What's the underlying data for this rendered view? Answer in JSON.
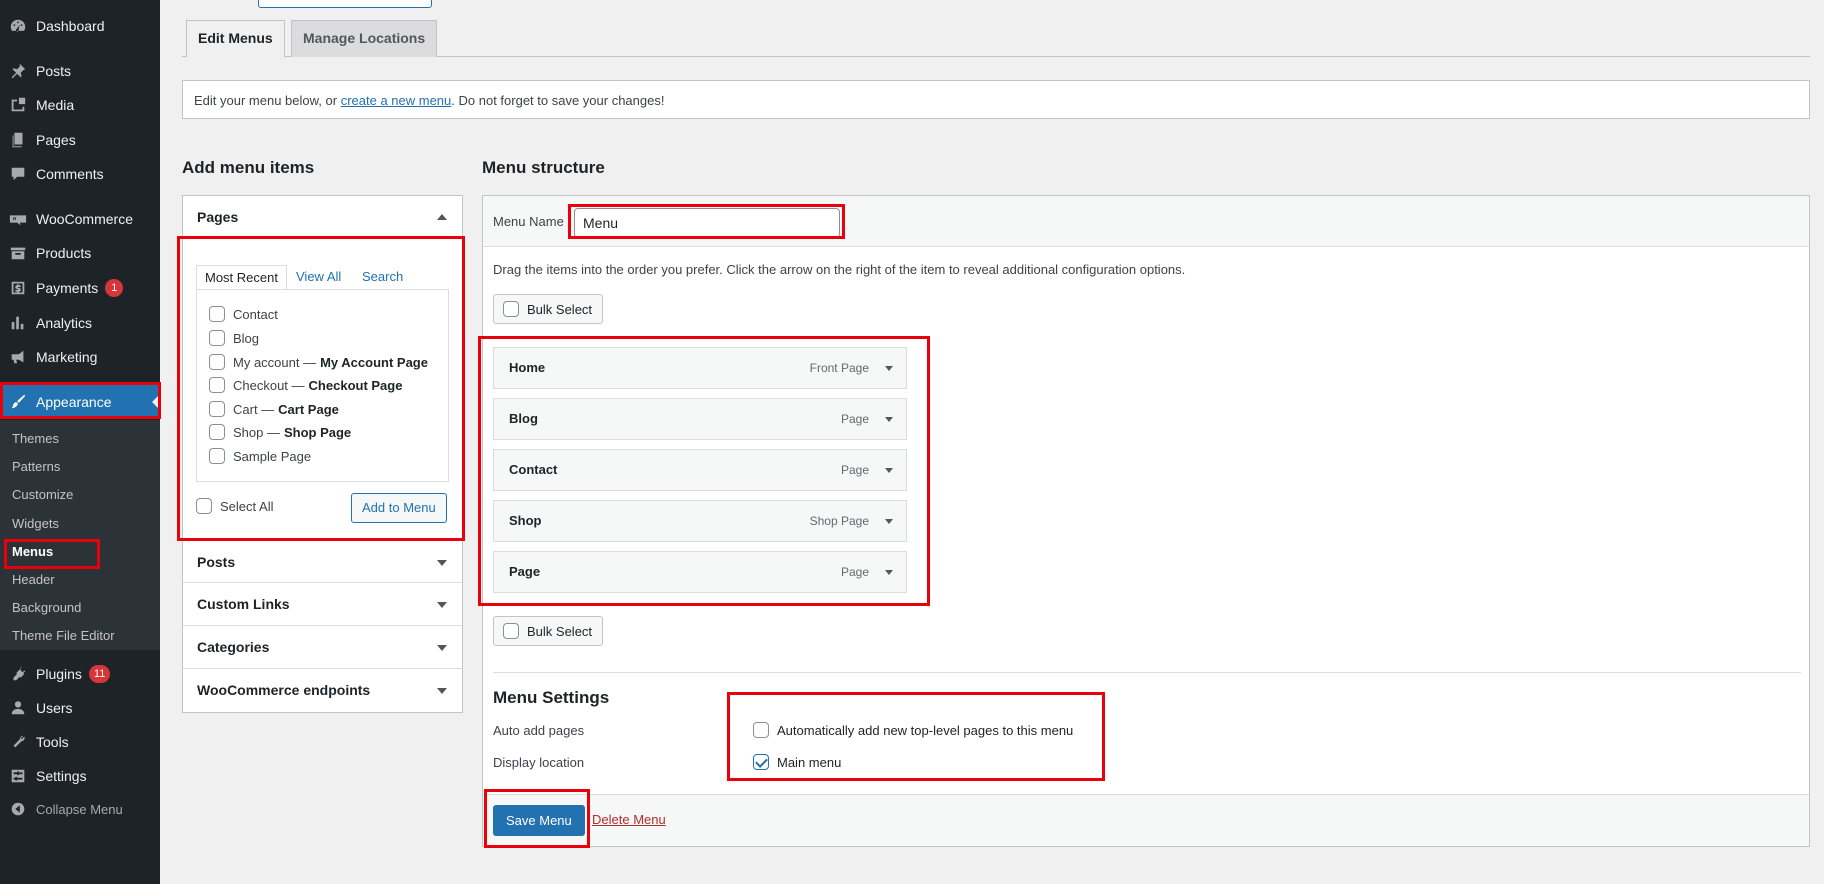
{
  "sidebar": {
    "items": [
      {
        "label": "Dashboard",
        "icon": "dashboard-icon"
      },
      {
        "label": "Posts",
        "icon": "pin-icon"
      },
      {
        "label": "Media",
        "icon": "media-icon"
      },
      {
        "label": "Pages",
        "icon": "pages-icon"
      },
      {
        "label": "Comments",
        "icon": "comment-icon"
      },
      {
        "label": "WooCommerce",
        "icon": "woo-icon"
      },
      {
        "label": "Products",
        "icon": "archive-icon"
      },
      {
        "label": "Payments",
        "icon": "dollar-icon",
        "badge": "1"
      },
      {
        "label": "Analytics",
        "icon": "bar-chart-icon"
      },
      {
        "label": "Marketing",
        "icon": "megaphone-icon"
      },
      {
        "label": "Appearance",
        "icon": "paint-brush-icon"
      },
      {
        "label": "Plugins",
        "icon": "plug-icon",
        "badge": "11"
      },
      {
        "label": "Users",
        "icon": "user-icon"
      },
      {
        "label": "Tools",
        "icon": "wrench-icon"
      },
      {
        "label": "Settings",
        "icon": "settings-icon"
      },
      {
        "label": "Collapse Menu",
        "icon": "collapse-icon"
      }
    ],
    "appearance_submenu": [
      "Themes",
      "Patterns",
      "Customize",
      "Widgets",
      "Menus",
      "Header",
      "Background",
      "Theme File Editor"
    ],
    "active_item": "Appearance",
    "current_subitem": "Menus"
  },
  "tabs": {
    "edit_menus": "Edit Menus",
    "manage_locations": "Manage Locations"
  },
  "notice": {
    "prefix": "Edit your menu below, or ",
    "link": "create a new menu",
    "suffix": ". Do not forget to save your changes!"
  },
  "add_items": {
    "heading": "Add menu items",
    "pages_title": "Pages",
    "inner_tabs": {
      "most_recent": "Most Recent",
      "view_all": "View All",
      "search": "Search"
    },
    "pages": [
      {
        "name": "Contact",
        "suffix": ""
      },
      {
        "name": "Blog",
        "suffix": ""
      },
      {
        "name": "My account —",
        "suffix": "My Account Page"
      },
      {
        "name": "Checkout —",
        "suffix": "Checkout Page"
      },
      {
        "name": "Cart —",
        "suffix": "Cart Page"
      },
      {
        "name": "Shop —",
        "suffix": "Shop Page"
      },
      {
        "name": "Sample Page",
        "suffix": ""
      }
    ],
    "select_all": "Select All",
    "add_button": "Add to Menu",
    "sections": [
      "Posts",
      "Custom Links",
      "Categories",
      "WooCommerce endpoints"
    ]
  },
  "menu_structure": {
    "heading": "Menu structure",
    "menu_name_label": "Menu Name",
    "menu_name_value": "Menu",
    "instructions": "Drag the items into the order you prefer. Click the arrow on the right of the item to reveal additional configuration options.",
    "bulk_select": "Bulk Select",
    "items": [
      {
        "title": "Home",
        "type": "Front Page"
      },
      {
        "title": "Blog",
        "type": "Page"
      },
      {
        "title": "Contact",
        "type": "Page"
      },
      {
        "title": "Shop",
        "type": "Shop Page"
      },
      {
        "title": "Page",
        "type": "Page"
      }
    ]
  },
  "menu_settings": {
    "heading": "Menu Settings",
    "auto_add_label": "Auto add pages",
    "auto_add_option": "Automatically add new top-level pages to this menu",
    "auto_add_checked": false,
    "display_location_label": "Display location",
    "display_location_option": "Main menu",
    "display_location_checked": true
  },
  "actions": {
    "save": "Save Menu",
    "delete": "Delete Menu"
  },
  "colors": {
    "sidebar_bg": "#1d2327",
    "accent": "#2271b1",
    "highlight": "#e8000b",
    "badge": "#d63638"
  }
}
